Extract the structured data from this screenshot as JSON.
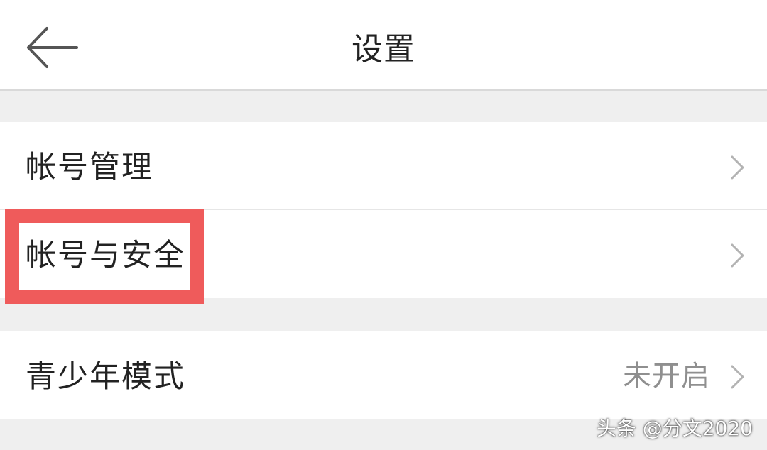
{
  "header": {
    "title": "设置",
    "back_icon": "arrow-left-icon"
  },
  "sections": [
    {
      "items": [
        {
          "label": "帐号管理",
          "icon": "chevron-right-icon"
        },
        {
          "label": "帐号与安全",
          "icon": "chevron-right-icon",
          "highlighted": true
        }
      ]
    },
    {
      "items": [
        {
          "label": "青少年模式",
          "value": "未开启",
          "icon": "chevron-right-icon"
        }
      ]
    }
  ],
  "annotation": {
    "highlight_color": "#ef5b5b"
  },
  "watermark": {
    "text": "头条 @分文2020"
  },
  "colors": {
    "background": "#efefef",
    "surface": "#ffffff",
    "text_primary": "#222222",
    "text_secondary": "#8f8f8f",
    "chevron": "#b3b3b3"
  }
}
